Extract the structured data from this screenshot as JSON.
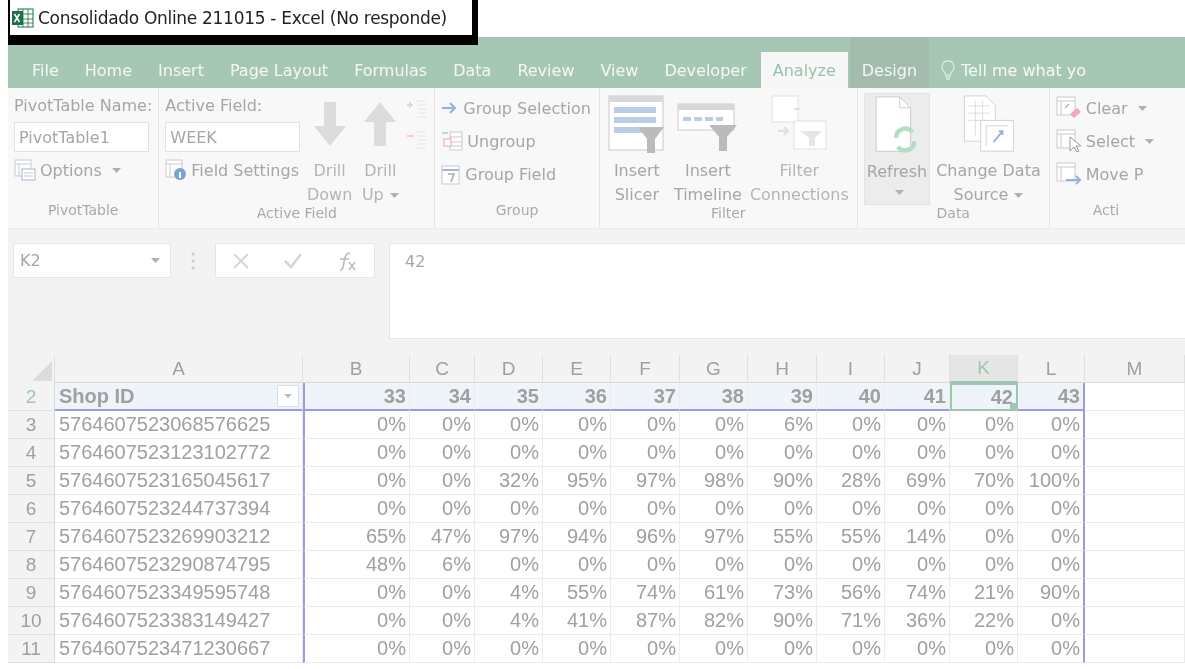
{
  "window": {
    "title": "Consolidado Online 211015 - Excel (No responde)"
  },
  "tabs": [
    {
      "label": "File",
      "selected": false,
      "contextual": false
    },
    {
      "label": "Home",
      "selected": false,
      "contextual": false
    },
    {
      "label": "Insert",
      "selected": false,
      "contextual": false
    },
    {
      "label": "Page Layout",
      "selected": false,
      "contextual": false
    },
    {
      "label": "Formulas",
      "selected": false,
      "contextual": false
    },
    {
      "label": "Data",
      "selected": false,
      "contextual": false
    },
    {
      "label": "Review",
      "selected": false,
      "contextual": false
    },
    {
      "label": "View",
      "selected": false,
      "contextual": false
    },
    {
      "label": "Developer",
      "selected": false,
      "contextual": false
    },
    {
      "label": "Analyze",
      "selected": true,
      "contextual": true
    },
    {
      "label": "Design",
      "selected": false,
      "contextual": true
    }
  ],
  "tell_me": {
    "placeholder": "Tell me what yo"
  },
  "ribbon_groups": [
    {
      "label": "PivotTable",
      "columns": [
        [
          {
            "kind": "label",
            "text": "PivotTable Name:",
            "disabled": false
          },
          {
            "kind": "field",
            "value": "PivotTable1",
            "disabled": false
          },
          {
            "kind": "small",
            "text": "Options",
            "dropdown": true,
            "disabled": false
          }
        ]
      ]
    },
    {
      "label": "Active Field",
      "columns": [
        [
          {
            "kind": "label",
            "text": "Active Field:",
            "disabled": false
          },
          {
            "kind": "field",
            "value": "WEEK",
            "disabled": false
          },
          {
            "kind": "small",
            "text": "Field Settings",
            "dropdown": false,
            "disabled": false
          }
        ],
        [
          {
            "kind": "large",
            "lines": [
              "Drill",
              "Down"
            ],
            "dropdown": false,
            "disabled": true,
            "highlighted": false
          }
        ],
        [
          {
            "kind": "large",
            "lines": [
              "Drill",
              "Up"
            ],
            "dropdown": true,
            "disabled": true,
            "highlighted": false
          }
        ],
        [
          {
            "kind": "icon",
            "disabled": true
          },
          {
            "kind": "icon",
            "disabled": true
          }
        ]
      ]
    },
    {
      "label": "Group",
      "columns": [
        [
          {
            "kind": "small",
            "text": "Group Selection",
            "dropdown": false,
            "disabled": false
          },
          {
            "kind": "small",
            "text": "Ungroup",
            "dropdown": false,
            "disabled": false
          },
          {
            "kind": "small",
            "text": "Group Field",
            "dropdown": false,
            "disabled": false
          }
        ]
      ]
    },
    {
      "label": "Filter",
      "columns": [
        [
          {
            "kind": "large",
            "lines": [
              "Insert",
              "Slicer"
            ],
            "dropdown": false,
            "disabled": false,
            "highlighted": false
          }
        ],
        [
          {
            "kind": "large",
            "lines": [
              "Insert",
              "Timeline"
            ],
            "dropdown": false,
            "disabled": false,
            "highlighted": false
          }
        ],
        [
          {
            "kind": "large",
            "lines": [
              "Filter",
              "Connections"
            ],
            "dropdown": false,
            "disabled": true,
            "highlighted": false
          }
        ]
      ]
    },
    {
      "label": "Data",
      "columns": [
        [
          {
            "kind": "large",
            "lines": [
              "Refresh"
            ],
            "dropdown": true,
            "disabled": false,
            "highlighted": true
          }
        ],
        [
          {
            "kind": "large",
            "lines": [
              "Change Data",
              "Source"
            ],
            "dropdown": true,
            "disabled": false,
            "highlighted": false
          }
        ]
      ]
    },
    {
      "label": "Acti",
      "columns": [
        [
          {
            "kind": "small",
            "text": "Clear",
            "dropdown": true,
            "disabled": false
          },
          {
            "kind": "small",
            "text": "Select",
            "dropdown": true,
            "disabled": false
          },
          {
            "kind": "small",
            "text": "Move P",
            "dropdown": false,
            "disabled": false
          }
        ]
      ]
    }
  ],
  "formula_bar": {
    "name_box": "K2",
    "formula": "42"
  },
  "columns": [
    {
      "letter": "A",
      "selected": false
    },
    {
      "letter": "B",
      "selected": false
    },
    {
      "letter": "C",
      "selected": false
    },
    {
      "letter": "D",
      "selected": false
    },
    {
      "letter": "E",
      "selected": false
    },
    {
      "letter": "F",
      "selected": false
    },
    {
      "letter": "G",
      "selected": false
    },
    {
      "letter": "H",
      "selected": false
    },
    {
      "letter": "I",
      "selected": false
    },
    {
      "letter": "J",
      "selected": false
    },
    {
      "letter": "K",
      "selected": true
    },
    {
      "letter": "L",
      "selected": false
    },
    {
      "letter": "M",
      "selected": false
    }
  ],
  "header_row": {
    "number": "2",
    "cells": [
      {
        "text": "Shop ID",
        "filter": true,
        "active": false
      },
      {
        "text": "33",
        "active": false
      },
      {
        "text": "34",
        "active": false
      },
      {
        "text": "35",
        "active": false
      },
      {
        "text": "36",
        "active": false
      },
      {
        "text": "37",
        "active": false
      },
      {
        "text": "38",
        "active": false
      },
      {
        "text": "39",
        "active": false
      },
      {
        "text": "40",
        "active": false
      },
      {
        "text": "41",
        "active": false
      },
      {
        "text": "42",
        "active": true
      },
      {
        "text": "43",
        "active": false
      }
    ]
  },
  "rows": [
    {
      "number": "3",
      "cells": [
        "5764607523068576625",
        "0%",
        "0%",
        "0%",
        "0%",
        "0%",
        "0%",
        "6%",
        "0%",
        "0%",
        "0%",
        "0%"
      ]
    },
    {
      "number": "4",
      "cells": [
        "5764607523123102772",
        "0%",
        "0%",
        "0%",
        "0%",
        "0%",
        "0%",
        "0%",
        "0%",
        "0%",
        "0%",
        "0%"
      ]
    },
    {
      "number": "5",
      "cells": [
        "5764607523165045617",
        "0%",
        "0%",
        "32%",
        "95%",
        "97%",
        "98%",
        "90%",
        "28%",
        "69%",
        "70%",
        "100%"
      ]
    },
    {
      "number": "6",
      "cells": [
        "5764607523244737394",
        "0%",
        "0%",
        "0%",
        "0%",
        "0%",
        "0%",
        "0%",
        "0%",
        "0%",
        "0%",
        "0%"
      ]
    },
    {
      "number": "7",
      "cells": [
        "5764607523269903212",
        "65%",
        "47%",
        "97%",
        "94%",
        "96%",
        "97%",
        "55%",
        "55%",
        "14%",
        "0%",
        "0%"
      ]
    },
    {
      "number": "8",
      "cells": [
        "5764607523290874795",
        "48%",
        "6%",
        "0%",
        "0%",
        "0%",
        "0%",
        "0%",
        "0%",
        "0%",
        "0%",
        "0%"
      ]
    },
    {
      "number": "9",
      "cells": [
        "5764607523349595748",
        "0%",
        "0%",
        "4%",
        "55%",
        "74%",
        "61%",
        "73%",
        "56%",
        "74%",
        "21%",
        "90%"
      ]
    },
    {
      "number": "10",
      "cells": [
        "5764607523383149427",
        "0%",
        "0%",
        "4%",
        "41%",
        "87%",
        "82%",
        "90%",
        "71%",
        "36%",
        "22%",
        "0%"
      ]
    },
    {
      "number": "11",
      "cells": [
        "5764607523471230667",
        "0%",
        "0%",
        "0%",
        "0%",
        "0%",
        "0%",
        "0%",
        "0%",
        "0%",
        "0%",
        "0%"
      ]
    }
  ]
}
